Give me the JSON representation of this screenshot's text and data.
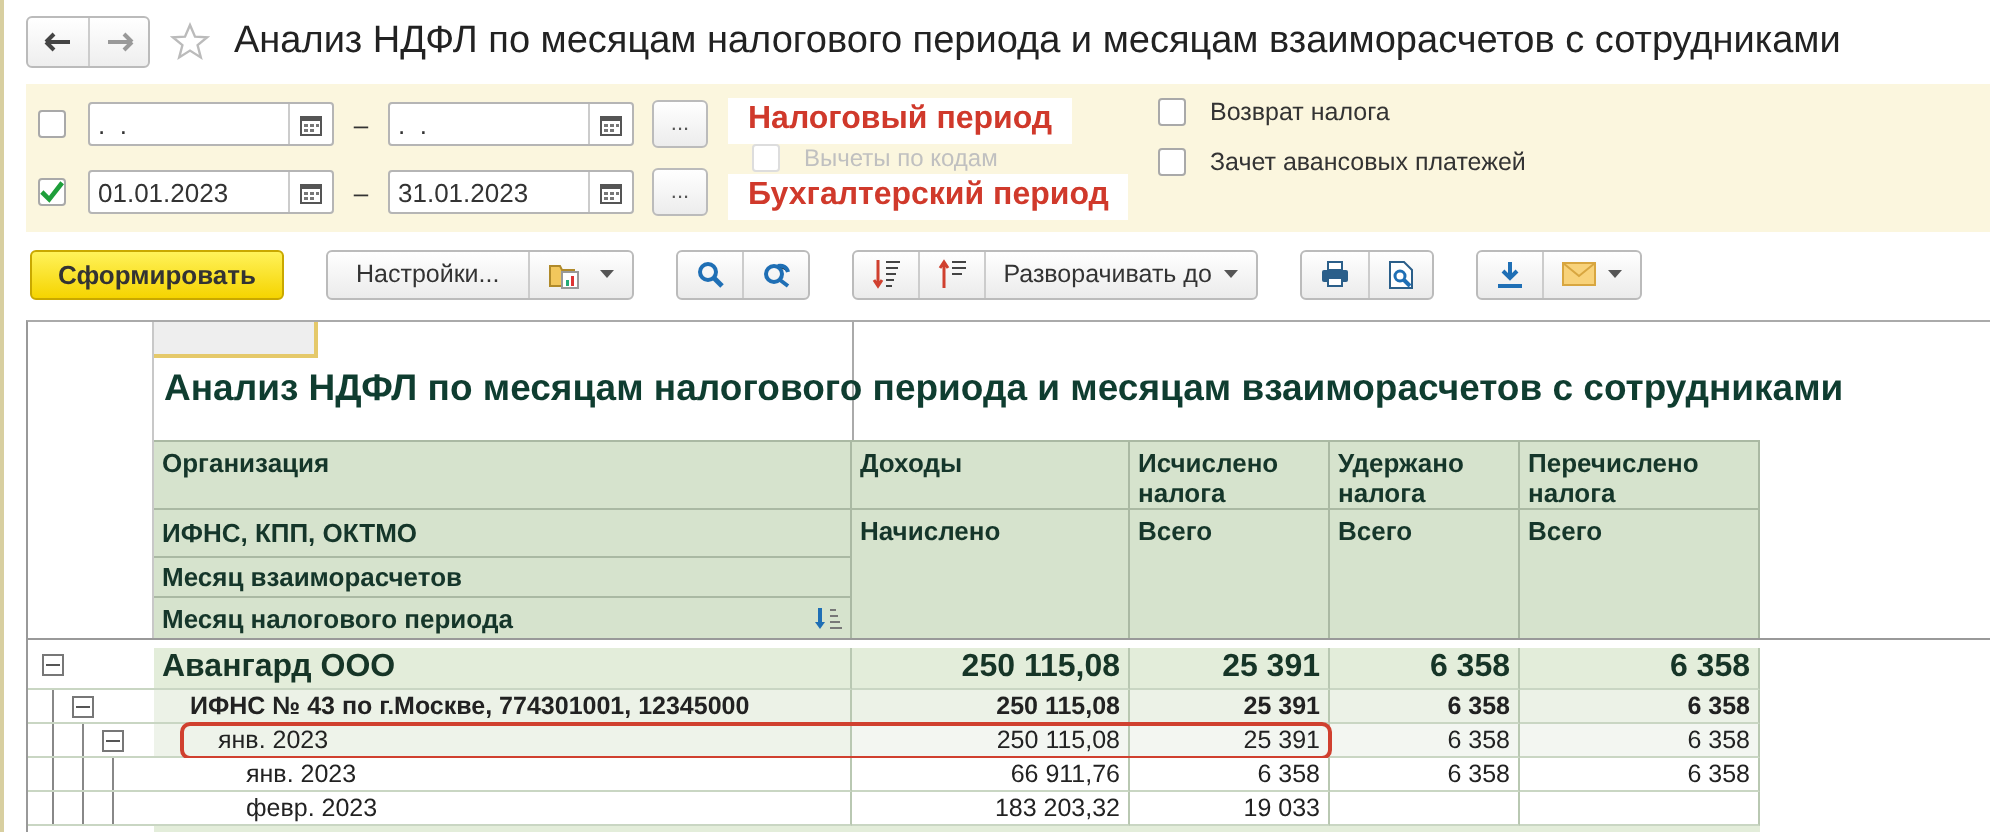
{
  "window": {
    "title": "Анализ НДФЛ по месяцам налогового периода и месяцам взаиморасчетов с сотрудниками",
    "favorite": false
  },
  "filters": [
    {
      "checked": false,
      "from": ".  .",
      "dash": "–",
      "to": ".  .",
      "more": "...",
      "annotation": "Налоговый период"
    },
    {
      "checked": true,
      "from": "01.01.2023",
      "dash": "–",
      "to": "31.01.2023",
      "more": "...",
      "annotation": "Бухгалтерский период"
    }
  ],
  "covered_option": {
    "label": "Вычеты по кодам",
    "checked": false,
    "disabled": true
  },
  "options": [
    {
      "label": "Возврат налога",
      "checked": false
    },
    {
      "label": "Зачет авансовых платежей",
      "checked": false
    }
  ],
  "toolbar": {
    "generate": "Сформировать",
    "settings": "Настройки...",
    "expand": "Разворачивать до"
  },
  "report": {
    "title": "Анализ НДФЛ по месяцам налогового периода и месяцам взаиморасчетов с сотрудниками",
    "row_fields": [
      "Организация",
      "ИФНС, КПП, ОКТМО",
      "Месяц взаиморасчетов",
      "Месяц налогового периода"
    ],
    "columns": [
      {
        "title": "Доходы",
        "subtitle": "Начислено"
      },
      {
        "title": "Исчислено налога",
        "subtitle": "Всего"
      },
      {
        "title": "Удержано налога",
        "subtitle": "Всего"
      },
      {
        "title": "Перечислено налога",
        "subtitle": "Всего"
      }
    ],
    "rows": [
      {
        "name": "Авангард ООО",
        "expanded": true,
        "highlighted": false,
        "values": {
          "income": "250 115,08",
          "calculated": "25 391",
          "withheld": "6 358",
          "transferred": "6 358"
        },
        "children": [
          {
            "name": "ИФНС № 43 по г.Москве, 774301001, 12345000",
            "expanded": true,
            "highlighted": false,
            "values": {
              "income": "250 115,08",
              "calculated": "25 391",
              "withheld": "6 358",
              "transferred": "6 358"
            },
            "children": [
              {
                "name": "янв. 2023",
                "expanded": true,
                "highlighted": true,
                "values": {
                  "income": "250 115,08",
                  "calculated": "25 391",
                  "withheld": "6 358",
                  "transferred": "6 358"
                },
                "children": [
                  {
                    "name": "янв. 2023",
                    "highlighted": false,
                    "values": {
                      "income": "66 911,76",
                      "calculated": "6 358",
                      "withheld": "6 358",
                      "transferred": "6 358"
                    }
                  },
                  {
                    "name": "февр. 2023",
                    "highlighted": false,
                    "values": {
                      "income": "183 203,32",
                      "calculated": "19 033"
                    }
                  }
                ]
              }
            ]
          }
        ]
      }
    ]
  }
}
